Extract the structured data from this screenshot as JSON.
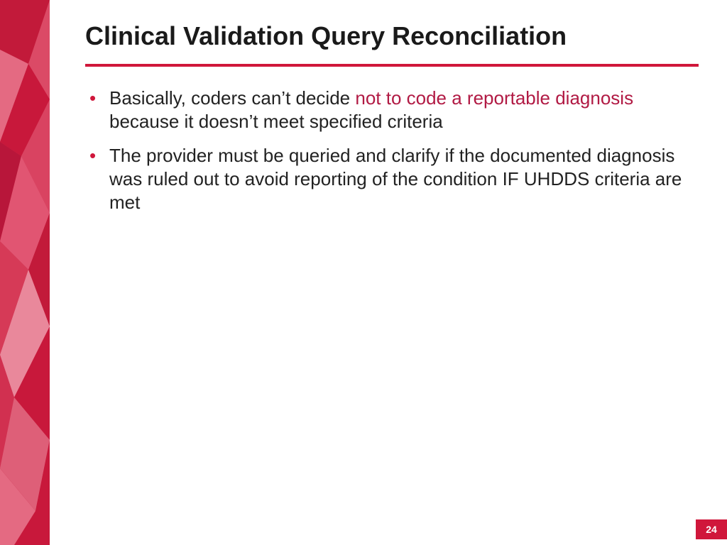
{
  "slide": {
    "title": "Clinical Validation Query Reconciliation",
    "bullets": [
      {
        "pre": "Basically, coders can’t decide ",
        "emph": "not to code a reportable diagnosis",
        "post": " because it doesn’t meet specified criteria"
      },
      {
        "pre": "The provider must be queried and clarify if the documented diagnosis was ruled out to avoid reporting of the condition IF UHDDS criteria are met",
        "emph": "",
        "post": ""
      }
    ],
    "page_number": "24"
  },
  "colors": {
    "accent": "#d0173b",
    "emph_text": "#b11a44"
  }
}
